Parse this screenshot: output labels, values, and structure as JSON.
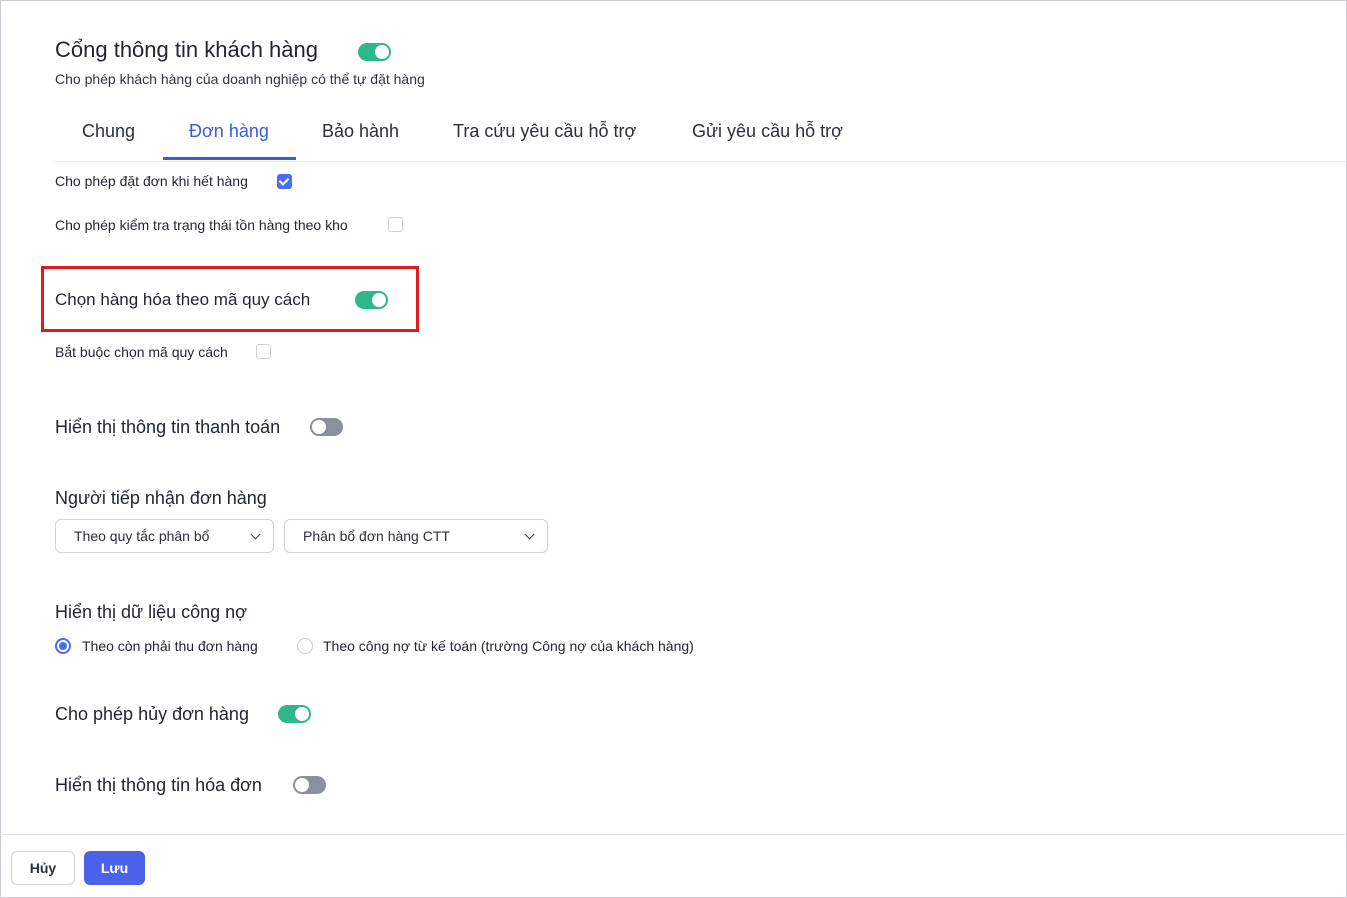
{
  "header": {
    "title": "Cổng thông tin khách hàng",
    "title_toggle_on": true,
    "subtitle": "Cho phép khách hàng của doanh nghiệp có thể tự đặt hàng"
  },
  "tabs": [
    {
      "label": "Chung",
      "active": false
    },
    {
      "label": "Đơn hàng",
      "active": true
    },
    {
      "label": "Bảo hành",
      "active": false
    },
    {
      "label": "Tra cứu yêu cầu hỗ trợ",
      "active": false
    },
    {
      "label": "Gửi yêu cầu hỗ trợ",
      "active": false
    }
  ],
  "settings": {
    "allow_out_of_stock": {
      "label": "Cho phép đặt đơn khi hết hàng",
      "checked": true
    },
    "check_stock_by_warehouse": {
      "label": "Cho phép kiểm tra trạng thái tồn hàng theo kho",
      "checked": false
    },
    "select_by_spec_code": {
      "label": "Chọn hàng hóa theo mã quy cách",
      "on": true
    },
    "require_spec_code": {
      "label": "Bắt buộc chọn mã quy cách",
      "checked": false
    },
    "show_payment_info": {
      "label": "Hiển thị thông tin thanh toán",
      "on": false
    },
    "order_receiver": {
      "label": "Người tiếp nhận đơn hàng",
      "rule_select": "Theo quy tắc phân bổ",
      "allocation_select": "Phân bổ đơn hàng CTT"
    },
    "debt_display": {
      "label": "Hiển thị dữ liệu công nợ",
      "options": [
        {
          "label": "Theo còn phải thu đơn hàng",
          "selected": true
        },
        {
          "label": "Theo công nợ từ kế toán (trường Công nợ của khách hàng)",
          "selected": false
        }
      ]
    },
    "allow_cancel_order": {
      "label": "Cho phép hủy đơn hàng",
      "on": true
    },
    "show_invoice_info": {
      "label": "Hiển thị thông tin hóa đơn",
      "on": false
    }
  },
  "footer": {
    "cancel_label": "Hủy",
    "save_label": "Lưu"
  },
  "colors": {
    "accent": "#3b5bdb",
    "toggle_on": "#2eb88a",
    "toggle_off": "#8b919c",
    "highlight": "#e01a22"
  }
}
